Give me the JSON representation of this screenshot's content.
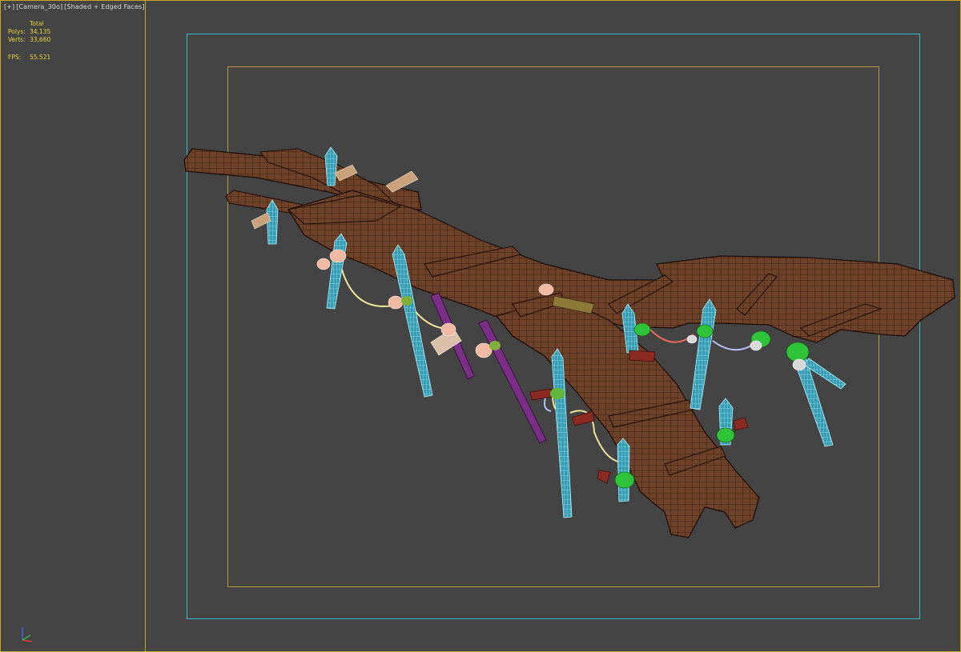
{
  "viewport": {
    "label_parts": [
      "[+]",
      "[Camera_30o]",
      "[Shaded + Edged Faces]"
    ],
    "stats": {
      "header": "Total",
      "polys_label": "Polys:",
      "polys_value": "34,135",
      "verts_label": "Verts:",
      "verts_value": "33,660",
      "fps_label": "FPS:",
      "fps_value": "55.521"
    },
    "axis_icon": "xyz-axis-tripod-icon"
  },
  "colors": {
    "background": "#444444",
    "active_border": "#c7a622",
    "safe_frame_outer": "#35b8c9",
    "safe_frame_inner": "#b89a3a",
    "wood": "#6e4129",
    "post_wire": "#62d3e8",
    "rope_yellow": "#efe39a",
    "rope_red": "#e56a5a",
    "clamp_green": "#2fc33a",
    "stake_purple": "#7a2e86",
    "wrap_pink": "#f2b9a2"
  }
}
